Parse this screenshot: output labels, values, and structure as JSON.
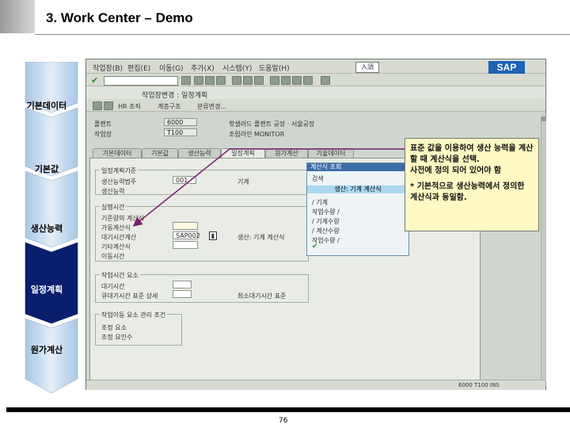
{
  "slide": {
    "title": "3. Work Center – Demo",
    "page_number": "76"
  },
  "process_steps": [
    {
      "label": "기본데이터",
      "active": false
    },
    {
      "label": "기본값",
      "active": false
    },
    {
      "label": "생산능력",
      "active": false
    },
    {
      "label": "일정계획",
      "active": true
    },
    {
      "label": "원가계산",
      "active": false
    }
  ],
  "sap": {
    "menu": [
      "작업장(B)",
      "편집(E)",
      "이동(G)",
      "추가(X)",
      "시스템(Y)",
      "도움말(H)"
    ],
    "input_mode": "入須",
    "logo": "SAP",
    "screen_title": "작업장변경 : 일정계획",
    "toolbar_buttons": [
      "HR 조직",
      "계층구조",
      "분류변경..."
    ],
    "header_fields": {
      "plant_label": "플랜트",
      "plant_value": "6000",
      "workcenter_label": "작업장",
      "workcenter_value": "T100",
      "plant_desc": "핫샐러드 플랜트 공장 · 서울공장",
      "workcenter_desc": "조립라인 MONITOR"
    },
    "tabs": [
      {
        "label": "기본데이터",
        "active": false
      },
      {
        "label": "기본값",
        "active": false
      },
      {
        "label": "생산능력",
        "active": false
      },
      {
        "label": "일정계획",
        "active": true
      },
      {
        "label": "원가계산",
        "active": false
      },
      {
        "label": "기술데이터",
        "active": false
      }
    ],
    "group_capacity": {
      "title": "일정계획기준",
      "capacity_category_label": "생산능력범주",
      "capacity_category_value": "001",
      "capacity_category_desc": "기계",
      "other_label": "생산능력"
    },
    "group_times": {
      "title": "실행시간",
      "rows": [
        "기준량의 계산식",
        "가동계산식",
        "대기시간계산",
        "기타계산식",
        "이동시간"
      ],
      "formula_value": "SAP002",
      "formula_desc": "생산: 기계 계산식"
    },
    "group_work": {
      "title": "작업시간 요소",
      "rows": [
        "대기시간",
        "큐대기시간 표준 상세"
      ],
      "desc": "최소대기시간 표준"
    },
    "group_cost": {
      "title": "작업이동 요소 관리 조건",
      "rows": [
        "조정 요소",
        "조정 요인수"
      ]
    },
    "dropdown": {
      "header": "계산식 조회",
      "search_label": "검색",
      "selected": "생산: 기계 계산식",
      "items": [
        "/ 기계",
        "작업수량 /",
        "/ 기계수량",
        "/ 계산수량",
        "작업수량 /"
      ]
    },
    "status": "6000  T100  INS"
  },
  "callout": {
    "text": "표준 값을 이용하여 생산 능력을 계산할 때 계산식을 선택.\n사전에 정의 되어 있어야 함",
    "note": "* 기본적으로 생산능력에서 정의한 계산식과 동일함."
  },
  "colors": {
    "arrow_fill": "#c9dcf0",
    "arrow_active": "#0a1e6e",
    "callout_bg": "#fff9c4",
    "sap_blue": "#1d62b5"
  }
}
